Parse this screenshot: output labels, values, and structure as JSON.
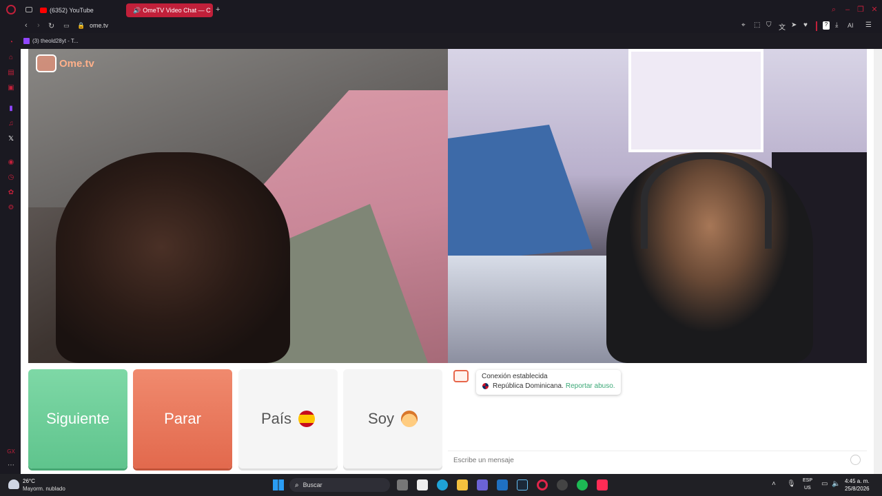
{
  "browser": {
    "tabs": [
      {
        "label": "(6352) YouTube",
        "active": false,
        "icon": "youtube-icon",
        "color": "#ff0000"
      },
      {
        "label": "OmeTV Video Chat — C",
        "active": true,
        "icon": "ometv-icon",
        "color": "#ff5a4a"
      }
    ],
    "url": "ome.tv",
    "bookmark": "(3) theold28yt - T...",
    "accent": "#c1203a",
    "toolbar_ai": "AI"
  },
  "page": {
    "logo_text": "Ome.tv",
    "buttons": {
      "next": "Siguiente",
      "stop": "Parar",
      "country": "País",
      "gender": "Soy"
    },
    "colors": {
      "next": "#6acf98",
      "stop": "#e9745a",
      "neutral": "#f5f5f5"
    },
    "chat": {
      "status": "Conexión establecida",
      "country": "República Dominicana.",
      "report_link": "Reportar abuso.",
      "placeholder": "Escribe un mensaje"
    }
  },
  "taskbar": {
    "weather_temp": "26°C",
    "weather_desc": "Mayorm. nublado",
    "search_label": "Buscar",
    "lang_line1": "ESP",
    "lang_line2": "US",
    "time": "4:45 a. m.",
    "date": "25/8/2026"
  }
}
